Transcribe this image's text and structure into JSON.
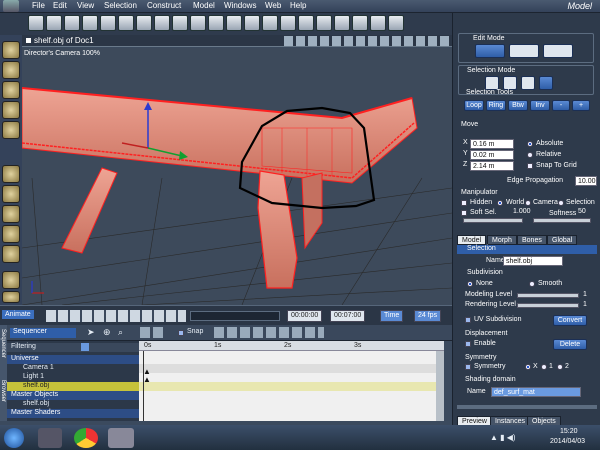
{
  "app": {
    "title": "Model"
  },
  "menu": [
    "File",
    "Edit",
    "View",
    "Selection",
    "Construct",
    "Model",
    "Windows",
    "Web",
    "Help"
  ],
  "viewport": {
    "doc_title": "shelf.obj of Doc1",
    "camera_label": "Director's Camera 100%"
  },
  "animation": {
    "button": "Animate",
    "time_start": "00:00:00",
    "time_end": "00:07:00",
    "time_mode": "Time",
    "fps": "24 fps"
  },
  "timeline": {
    "sequencer": "Sequencer",
    "filtering": "Filtering",
    "snap_label": "Snap",
    "side_tabs": [
      "Sequencer",
      "Browser"
    ],
    "ruler_marks": [
      "0s",
      "1s",
      "2s",
      "3s"
    ],
    "tree": [
      {
        "label": "Universe",
        "type": "header"
      },
      {
        "label": "Camera 1",
        "type": "item"
      },
      {
        "label": "Light 1",
        "type": "item"
      },
      {
        "label": "shelf.obj",
        "type": "selected"
      },
      {
        "label": "Master Objects",
        "type": "header"
      },
      {
        "label": "shelf.obj",
        "type": "item"
      },
      {
        "label": "Master Shaders",
        "type": "header"
      }
    ]
  },
  "panel": {
    "edit_mode": "Edit Mode",
    "selection_mode": "Selection Mode",
    "selection_tools": "Selection Tools",
    "tool_buttons": [
      "Loop",
      "Ring",
      "Btw",
      "Inv",
      "-",
      "+"
    ],
    "move": "Move",
    "coords": [
      {
        "axis": "X",
        "value": "0.16 m"
      },
      {
        "axis": "Y",
        "value": "0.02 m"
      },
      {
        "axis": "Z",
        "value": "2.14 m"
      }
    ],
    "move_options": [
      {
        "label": "Absolute",
        "on": true
      },
      {
        "label": "Relative",
        "on": false
      },
      {
        "label": "Snap To Grid",
        "on": false
      }
    ],
    "edge_propagation_label": "Edge Propagation",
    "edge_propagation_value": "10.00",
    "manipulator": "Manipulator",
    "manip_hidden": "Hidden",
    "manip_world": "World",
    "manip_camera": "Camera",
    "manip_selection": "Selection",
    "soft_sel": "Soft Sel.",
    "soft_sel_value": "1.000",
    "softness": "Softness",
    "softness_value": "50",
    "tabs": [
      "Model",
      "Morph",
      "Bones",
      "Global"
    ],
    "selection_header": "Selection",
    "name_label": "Name",
    "name_value": "shelf.obj",
    "subdivision": "Subdivision",
    "sub_none": "None",
    "sub_smooth": "Smooth",
    "modeling_level": "Modeling Level",
    "modeling_level_value": "1",
    "rendering_level": "Rendering Level",
    "rendering_level_value": "1",
    "uv_subdivision": "UV Subdivision",
    "convert": "Convert",
    "displacement": "Displacement",
    "enable": "Enable",
    "delete": "Delete",
    "symmetry": "Symmetry",
    "sym_label": "Symmetry",
    "sym_x": "X",
    "sym_1": "1",
    "sym_2": "2",
    "shading_domain": "Shading domain",
    "shading_name_label": "Name",
    "shading_name_value": "def_surf_mat",
    "bottom_tabs": [
      "Preview",
      "Instances",
      "Objects"
    ]
  },
  "taskbar": {
    "time": "15:20",
    "date": "2014/04/03"
  },
  "colors": {
    "mesh": "#e08070",
    "wire": "#ff2020",
    "accent": "#2f5ea8"
  }
}
